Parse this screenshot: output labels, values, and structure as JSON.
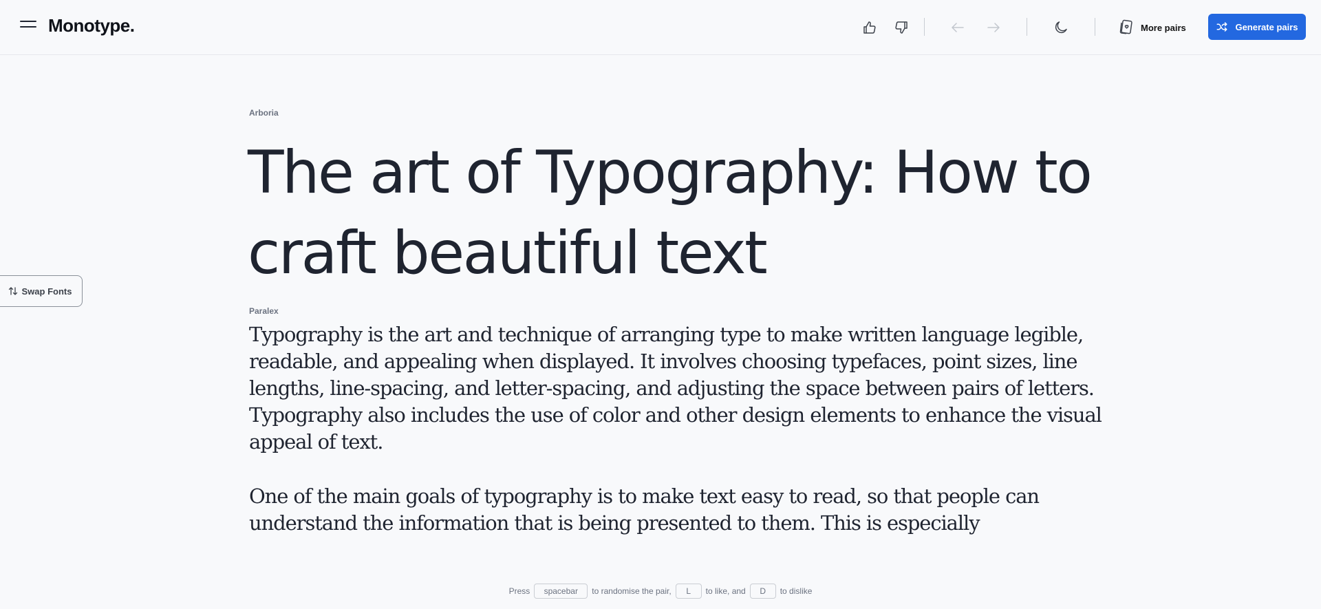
{
  "header": {
    "logo": "Monotype.",
    "more_pairs_label": "More pairs",
    "generate_label": "Generate pairs"
  },
  "heading_font_label": "Arboria",
  "headline": "The art of Typography: How to craft beautiful text",
  "body_font_label": "Paralex",
  "paragraphs": [
    "Typography is the art and technique of arranging type to make written language legible, readable, and appealing when displayed. It involves choosing typefaces, point sizes, line lengths, line-spacing, and letter-spacing, and adjusting the space between pairs of letters. Typography also includes the use of color and other design elements to enhance the visual appeal of text.",
    "One of the main goals of typography is to make text easy to read, so that people can understand the information that is being presented to them. This is especially"
  ],
  "swap_label": "Swap Fonts",
  "hint": {
    "press": "Press",
    "key_space": "spacebar",
    "randomise": "to randomise the pair,",
    "key_like": "L",
    "to_like": "to like, and",
    "key_dislike": "D",
    "to_dislike": "to dislike"
  },
  "colors": {
    "accent": "#2368e0",
    "text": "#1f2430",
    "muted": "#6b7280",
    "background": "#f8f9fb"
  },
  "icons": [
    "menu-icon",
    "thumbs-up-icon",
    "thumbs-down-icon",
    "arrow-left-icon",
    "arrow-right-icon",
    "moon-icon",
    "cards-icon",
    "shuffle-icon",
    "swap-icon"
  ]
}
